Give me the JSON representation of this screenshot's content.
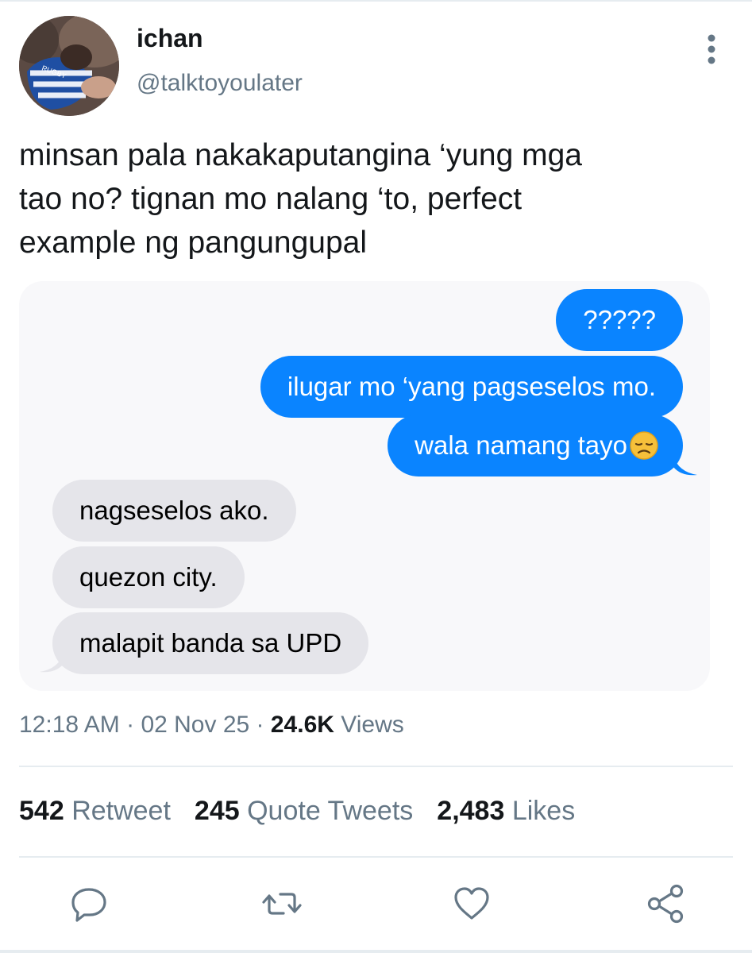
{
  "user": {
    "display_name": "ichan",
    "handle": "@talktoyoulater",
    "avatar_jersey_text": "RUGBY"
  },
  "tweet": {
    "text": "minsan pala nakakaputangina ‘yung mga\ntao no? tignan mo nalang ‘to, perfect\nexample ng pangungupal"
  },
  "chat": {
    "sent": [
      {
        "text": "?????"
      },
      {
        "text": "ilugar mo ‘yang pagseselos mo."
      },
      {
        "text": "wala namang tayo",
        "emoji": "😞"
      }
    ],
    "received": [
      {
        "text": "nagseselos ako."
      },
      {
        "text": "quezon city."
      },
      {
        "text": "malapit banda sa UPD"
      }
    ],
    "colors": {
      "sent_bubble": "#0a84ff",
      "received_bubble": "#e5e5ea"
    }
  },
  "meta": {
    "time": "12:18 AM",
    "separator": " · ",
    "date": "02 Nov 25",
    "views_count": "24.6K",
    "views_label": "Views"
  },
  "stats": {
    "retweets_count": "542",
    "retweets_label": "Retweet",
    "quotes_count": "245",
    "quotes_label": "Quote Tweets",
    "likes_count": "2,483",
    "likes_label": "Likes"
  },
  "actions": [
    "reply-icon",
    "retweet-icon",
    "like-icon",
    "share-icon"
  ],
  "colors": {
    "secondary_text": "#657786",
    "primary_text": "#14171a",
    "divider": "#e6ecf0"
  }
}
